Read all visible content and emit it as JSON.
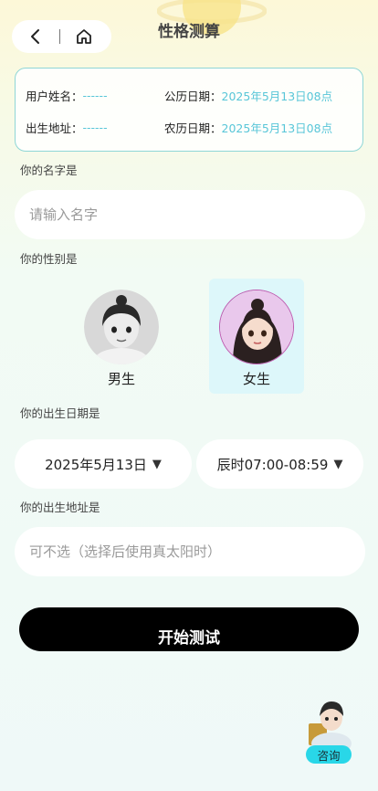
{
  "header": {
    "title": "性格测算",
    "back_icon": "chevron-left-icon",
    "home_icon": "home-icon"
  },
  "info_card": {
    "name_label": "用户姓名：",
    "name_value": "------",
    "solar_label": "公历日期：",
    "solar_value": "2025年5月13日08点",
    "address_label": "出生地址：",
    "address_value": "------",
    "lunar_label": "农历日期：",
    "lunar_value": "2025年5月13日08点"
  },
  "name_section": {
    "label": "你的名字是",
    "placeholder": "请输入名字"
  },
  "gender_section": {
    "label": "你的性别是",
    "options": [
      {
        "label": "男生",
        "selected": false
      },
      {
        "label": "女生",
        "selected": true
      }
    ]
  },
  "birth_date_section": {
    "label": "你的出生日期是",
    "date_value": "2025年5月13日",
    "time_value": "辰时07:00-08:59",
    "caret": "▼"
  },
  "birth_address_section": {
    "label": "你的出生地址是",
    "placeholder": "可不选（选择后使用真太阳时）"
  },
  "start_button": {
    "label": "开始测试"
  },
  "consult": {
    "label": "咨询"
  },
  "colors": {
    "accent": "#58c6d8",
    "card_border": "#8fd6d6",
    "selected_bg": "#ddf7fa",
    "button_bg": "#000000",
    "consult_badge": "#29d7e8"
  }
}
